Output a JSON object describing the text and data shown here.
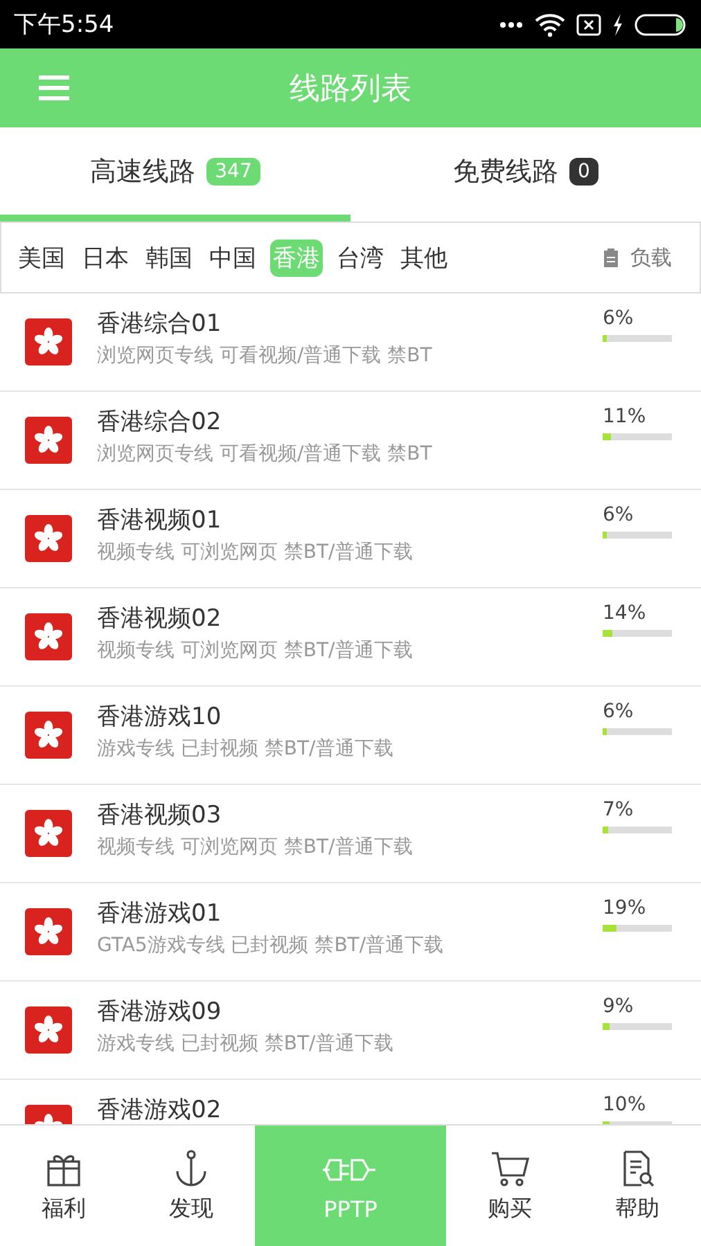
{
  "status_bar": {
    "time": "下午5:54"
  },
  "header": {
    "title": "线路列表"
  },
  "tabs": [
    {
      "label": "高速线路",
      "count": "347",
      "selected": true
    },
    {
      "label": "免费线路",
      "count": "0",
      "selected": false
    }
  ],
  "regions": [
    {
      "label": "美国",
      "selected": false
    },
    {
      "label": "日本",
      "selected": false
    },
    {
      "label": "韩国",
      "selected": false
    },
    {
      "label": "中国",
      "selected": false
    },
    {
      "label": "香港",
      "selected": true
    },
    {
      "label": "台湾",
      "selected": false
    },
    {
      "label": "其他",
      "selected": false
    }
  ],
  "sort": {
    "label": "负载"
  },
  "servers": [
    {
      "name": "香港综合01",
      "desc": "浏览网页专线 可看视频/普通下载 禁BT",
      "load": "6%",
      "level": 0.06
    },
    {
      "name": "香港综合02",
      "desc": "浏览网页专线 可看视频/普通下载 禁BT",
      "load": "11%",
      "level": 0.11
    },
    {
      "name": "香港视频01",
      "desc": "视频专线 可浏览网页 禁BT/普通下载",
      "load": "6%",
      "level": 0.06
    },
    {
      "name": "香港视频02",
      "desc": "视频专线 可浏览网页 禁BT/普通下载",
      "load": "14%",
      "level": 0.14
    },
    {
      "name": "香港游戏10",
      "desc": "游戏专线 已封视频 禁BT/普通下载",
      "load": "6%",
      "level": 0.06
    },
    {
      "name": "香港视频03",
      "desc": "视频专线 可浏览网页 禁BT/普通下载",
      "load": "7%",
      "level": 0.07
    },
    {
      "name": "香港游戏01",
      "desc": "GTA5游戏专线 已封视频 禁BT/普通下载",
      "load": "19%",
      "level": 0.19
    },
    {
      "name": "香港游戏09",
      "desc": "游戏专线 已封视频 禁BT/普通下载",
      "load": "9%",
      "level": 0.09
    },
    {
      "name": "香港游戏02",
      "load": "10%",
      "level": 0.1
    }
  ],
  "nav": [
    {
      "label": "福利",
      "kind": "gift",
      "selected": false
    },
    {
      "label": "发现",
      "kind": "anchor",
      "selected": false
    },
    {
      "label": "PPTP",
      "kind": "plug",
      "selected": true
    },
    {
      "label": "购买",
      "kind": "cart",
      "selected": false
    },
    {
      "label": "帮助",
      "kind": "help",
      "selected": false
    }
  ]
}
